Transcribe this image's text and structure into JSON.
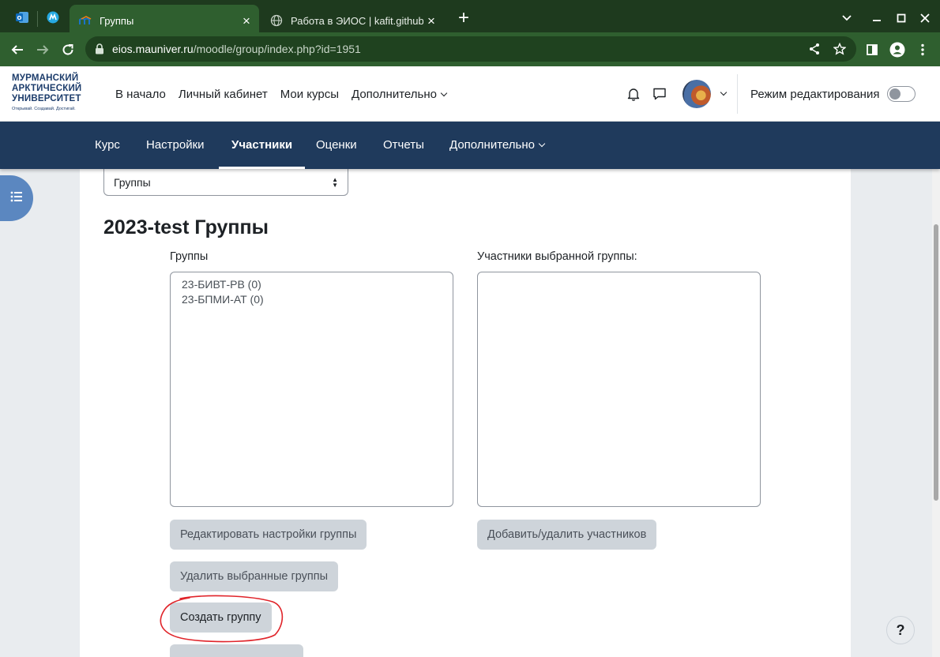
{
  "browser": {
    "tabs": [
      {
        "title": "Группы",
        "active": true
      },
      {
        "title": "Работа в ЭИОС | kafit.github.io",
        "active": false
      }
    ],
    "address": {
      "host": "eios.mauniver.ru",
      "path": "/moodle/group/index.php?id=1951"
    },
    "icons": {
      "pinned_1": "outlook-icon",
      "pinned_2": "app-icon",
      "new_tab": "plus-icon"
    }
  },
  "header": {
    "logo": {
      "line1": "МУРМАНСКИЙ",
      "line2": "АРКТИЧЕСКИЙ",
      "line3": "УНИВЕРСИТЕТ",
      "tagline": "Открывай. Создавай. Достигай."
    },
    "nav": [
      "В начало",
      "Личный кабинет",
      "Мои курсы",
      "Дополнительно"
    ],
    "edit_mode_label": "Режим редактирования",
    "edit_mode_on": false
  },
  "course_nav": {
    "items": [
      "Курс",
      "Настройки",
      "Участники",
      "Оценки",
      "Отчеты",
      "Дополнительно"
    ],
    "active": "Участники"
  },
  "page": {
    "select_value": "Группы",
    "title": "2023-test Группы",
    "groups_label": "Группы",
    "members_label": "Участники выбранной группы:",
    "groups": [
      "23-БИВТ-РВ (0)",
      "23-БПМИ-АТ (0)"
    ],
    "members": [],
    "buttons": {
      "edit_group": "Редактировать настройки группы",
      "add_remove": "Добавить/удалить участников",
      "delete_groups": "Удалить выбранные группы",
      "create_group": "Создать группу"
    },
    "help": "?"
  },
  "colors": {
    "browser_dark": "#1e3a1e",
    "browser_toolbar": "#2f5f2f",
    "course_nav": "#1f3a5c",
    "annotation": "#e0242a"
  }
}
